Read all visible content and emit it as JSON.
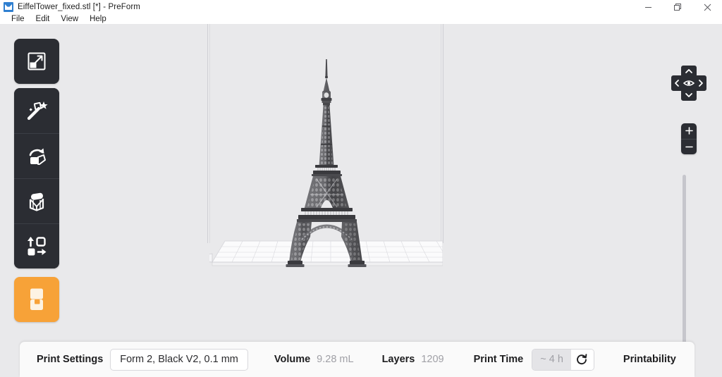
{
  "window": {
    "title": "EiffelTower_fixed.stl [*] - PreForm",
    "app_icon": "preform-app-icon",
    "controls": {
      "minimize": "minimize-icon",
      "restore": "restore-icon",
      "close": "close-icon"
    }
  },
  "menubar": {
    "items": [
      {
        "label": "File"
      },
      {
        "label": "Edit"
      },
      {
        "label": "View"
      },
      {
        "label": "Help"
      }
    ]
  },
  "toolbar": {
    "items": [
      {
        "name": "scale-tool",
        "icon": "scale-icon",
        "tooltip": "Scale"
      },
      {
        "name": "orientation-tool",
        "icon": "magic-wand-icon",
        "tooltip": "Orientation"
      },
      {
        "name": "rotate-tool",
        "icon": "rotate-icon",
        "tooltip": "Rotate"
      },
      {
        "name": "supports-tool",
        "icon": "supports-icon",
        "tooltip": "Supports"
      },
      {
        "name": "layout-tool",
        "icon": "layout-arrows-icon",
        "tooltip": "Layout"
      },
      {
        "name": "print-job-button",
        "icon": "printer-form-icon",
        "tooltip": "Print"
      }
    ],
    "accent_color": "#f7a238",
    "surface_color": "#2b2d33"
  },
  "viewport": {
    "background_color": "#e9e9eb",
    "model_name": "EiffelTower_fixed.stl",
    "model_color": "#5a5a5e",
    "platform_label": "build-platform-grid",
    "nav": {
      "up": "chevron-up-icon",
      "down": "chevron-down-icon",
      "left": "chevron-left-icon",
      "right": "chevron-right-icon",
      "center": "eye-icon",
      "zoom_in": "plus-icon",
      "zoom_out": "minus-icon"
    },
    "slider": "vertical-slice-slider"
  },
  "statusbar": {
    "print_settings_label": "Print Settings",
    "print_settings_value": "Form 2, Black V2, 0.1 mm",
    "volume_label": "Volume",
    "volume_value": "9.28 mL",
    "layers_label": "Layers",
    "layers_value": "1209",
    "print_time_label": "Print Time",
    "print_time_value": "~ 4 h",
    "print_time_refresh_icon": "refresh-icon",
    "printability_label": "Printability"
  }
}
